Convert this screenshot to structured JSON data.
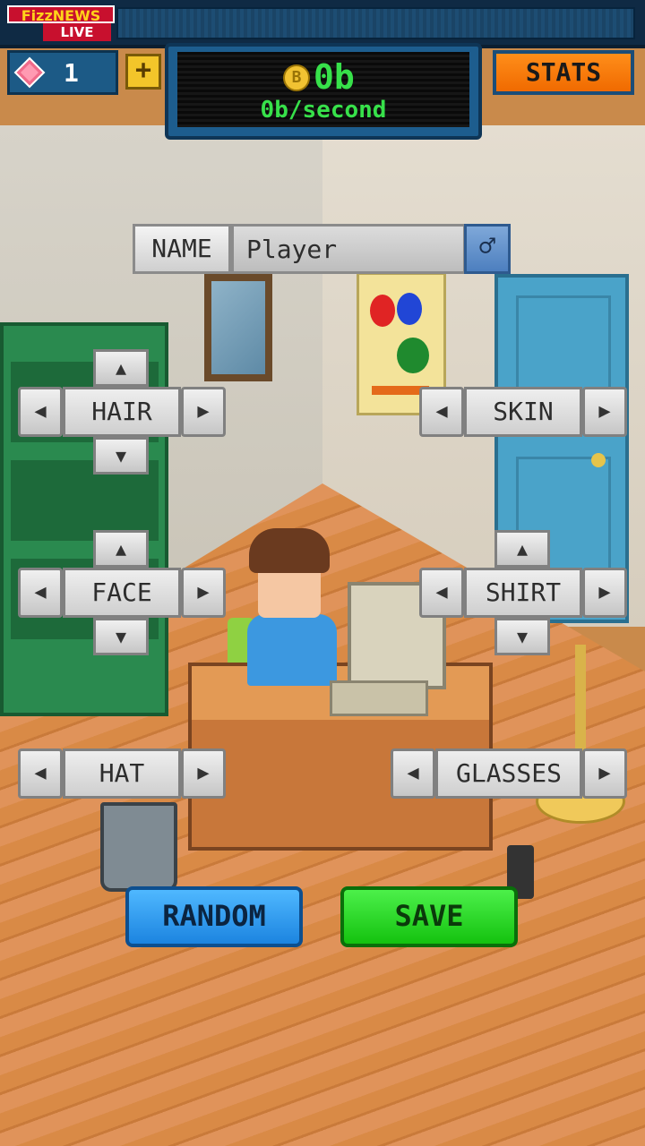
{
  "header": {
    "news_logo_top": "FizzNEWS",
    "news_logo_bottom": "LIVE",
    "gem_count": "1",
    "plus_label": "+",
    "coin_symbol": "B",
    "money_value": "0b",
    "money_rate": "0b/second",
    "stats_label": "STATS"
  },
  "name_row": {
    "label": "NAME",
    "value": "Player",
    "gender_symbol": "♂"
  },
  "selectors": {
    "hair": "HAIR",
    "skin": "SKIN",
    "face": "FACE",
    "shirt": "SHIRT",
    "hat": "HAT",
    "glasses": "GLASSES",
    "left_arrow": "◀",
    "right_arrow": "▶",
    "up_arrow": "▲",
    "down_arrow": "▼"
  },
  "actions": {
    "random_label": "RANDOM",
    "save_label": "SAVE"
  },
  "colors": {
    "stats_button": "#f06a00",
    "random_button": "#1c84e0",
    "save_button": "#14c20f",
    "money_text": "#37e14a"
  }
}
